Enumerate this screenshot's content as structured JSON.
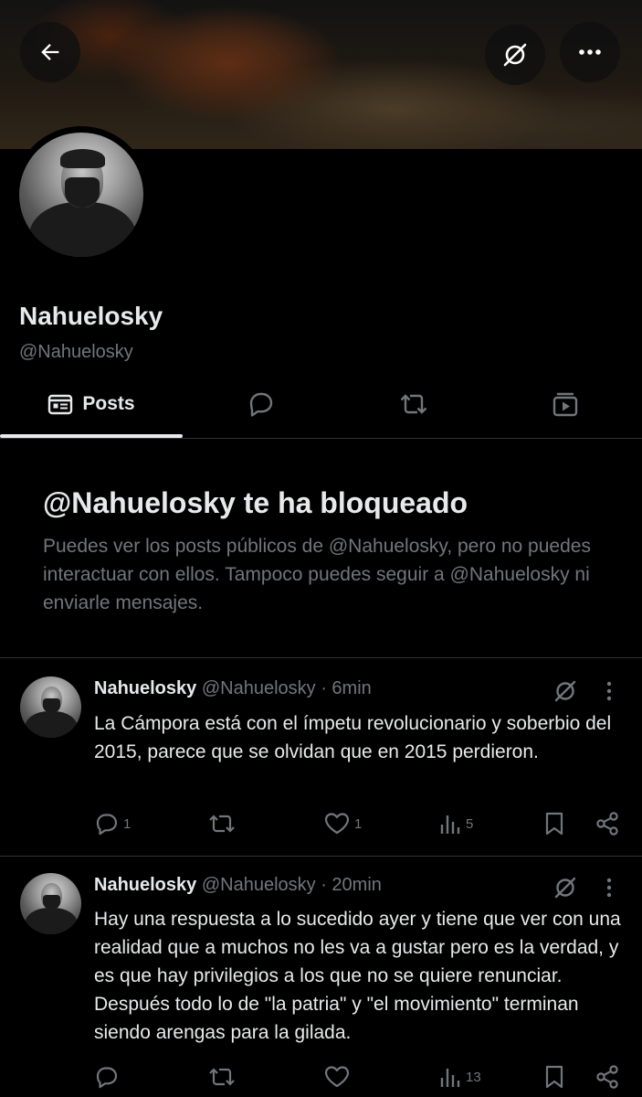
{
  "profile": {
    "name": "Nahuelosky",
    "handle": "@Nahuelosky"
  },
  "tabs": [
    {
      "label": "Posts",
      "icon": "posts-icon",
      "active": true
    },
    {
      "label": "",
      "icon": "replies-icon",
      "active": false
    },
    {
      "label": "",
      "icon": "reposts-icon",
      "active": false
    },
    {
      "label": "",
      "icon": "media-icon",
      "active": false
    }
  ],
  "blocked": {
    "title": "@Nahuelosky te ha bloqueado",
    "text": "Puedes ver los posts públicos de @Nahuelosky, pero no puedes interactuar con ellos. Tampoco puedes seguir a @Nahuelosky ni enviarle mensajes."
  },
  "posts": [
    {
      "name": "Nahuelosky",
      "meta": "@Nahuelosky · 6min",
      "text": "La Cámpora está con el ímpetu revolucionario y soberbio del 2015, parece que se olvidan que en 2015 perdieron.",
      "replies": "1",
      "reposts": "",
      "likes": "1",
      "views": "5"
    },
    {
      "name": "Nahuelosky",
      "meta": "@Nahuelosky · 20min",
      "text": "Hay una respuesta a lo sucedido ayer y tiene que ver con una realidad que a muchos no les va a gustar pero es la verdad, y es que hay privilegios a los que no se quiere renunciar. Después todo lo de \"la patria\" y \"el movimiento\" terminan siendo arengas para la gilada.",
      "replies": "",
      "reposts": "",
      "likes": "",
      "views": "13"
    }
  ],
  "colors": {
    "background": "#000000",
    "text_primary": "#e7e9ea",
    "text_secondary": "#71767b",
    "divider": "#2f3336"
  }
}
